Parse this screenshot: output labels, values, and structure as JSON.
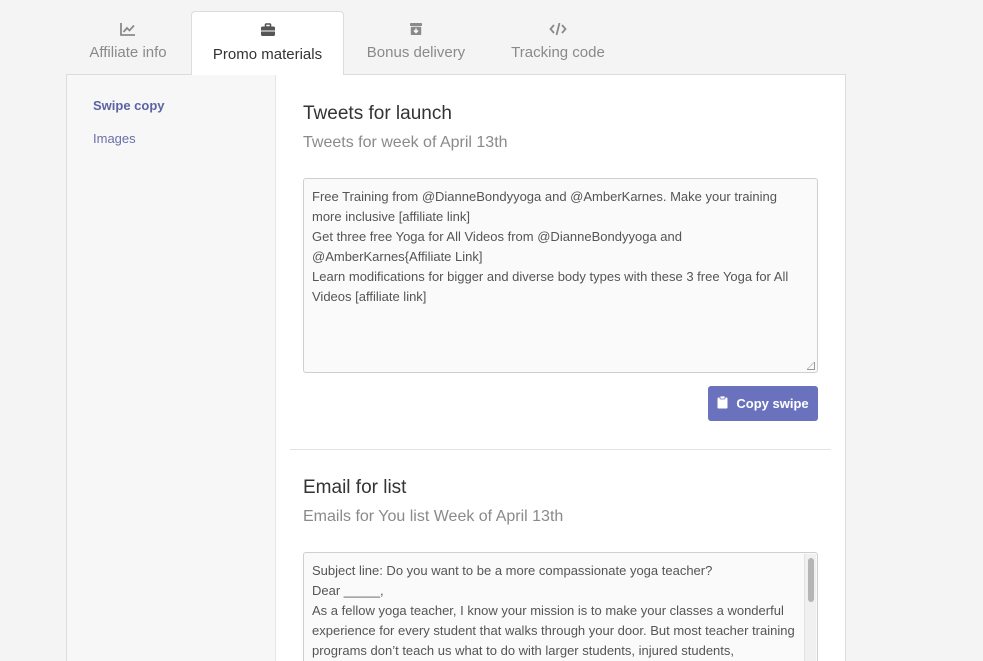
{
  "tabs": [
    {
      "label": "Affiliate info",
      "icon": "chart-line-icon",
      "active": false
    },
    {
      "label": "Promo materials",
      "icon": "briefcase-icon",
      "active": true
    },
    {
      "label": "Bonus delivery",
      "icon": "gift-box-icon",
      "active": false
    },
    {
      "label": "Tracking code",
      "icon": "code-icon",
      "active": false
    }
  ],
  "sidebar": {
    "items": [
      {
        "label": "Swipe copy",
        "active": true
      },
      {
        "label": "Images",
        "active": false
      }
    ]
  },
  "sections": [
    {
      "title": "Tweets for launch",
      "subtitle": "Tweets for week of April 13th",
      "lines": [
        "Free Training from @DianneBondyyoga and @AmberKarnes. Make your training more inclusive [affiliate link]",
        "Get three free Yoga for All Videos from @DianneBondyyoga and @AmberKarnes{Affiliate Link]",
        "Learn modifications for bigger and diverse body types with these 3 free Yoga for All Videos [affiliate link]"
      ],
      "button_label": "Copy swipe"
    },
    {
      "title": "Email for list",
      "subtitle": "Emails for You list Week of April 13th",
      "lines": [
        "Subject line: Do you want to be a more compassionate yoga teacher?",
        "Dear _____,",
        "As a fellow yoga teacher, I know your mission is to make your classes a wonderful experience for every student that walks through your door. But most teacher training programs don’t teach us what to do with larger students, injured students,"
      ]
    }
  ],
  "colors": {
    "accent": "#6b72bd",
    "sidebar_link": "#6a6fa8"
  }
}
